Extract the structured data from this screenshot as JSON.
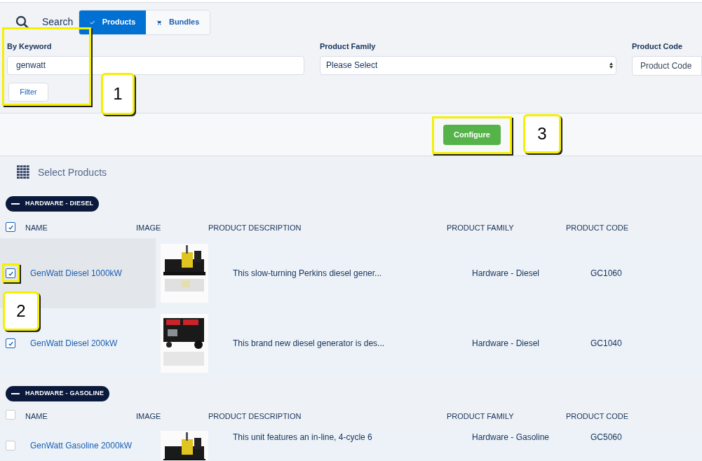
{
  "search": {
    "label": "Search",
    "tabs": [
      {
        "label": "Products",
        "kind": "check",
        "selected": true
      },
      {
        "label": "Bundles",
        "kind": "cart",
        "selected": false
      }
    ]
  },
  "filters": {
    "keyword": {
      "label": "By Keyword",
      "value": "genwatt",
      "button": "Filter",
      "callout": "1"
    },
    "family": {
      "label": "Product Family",
      "value": "Please Select"
    },
    "code": {
      "label": "Product Code",
      "placeholder": "Product Code"
    }
  },
  "configure": {
    "button": "Configure",
    "callout": "3"
  },
  "heading": "Select Products",
  "groups": [
    {
      "label": "HARDWARE - DIESEL",
      "expanded": true,
      "all_checked": true,
      "columns": [
        "NAME",
        "IMAGE",
        "PRODUCT DESCRIPTION",
        "PRODUCT FAMILY",
        "PRODUCT CODE"
      ],
      "rows": [
        {
          "name": "GenWatt Diesel 1000kW",
          "description": "This slow-turning Perkins diesel gener...",
          "family": "Hardware - Diesel",
          "code": "GC1060",
          "checked": true,
          "selected": true,
          "callout": "2"
        },
        {
          "name": "GenWatt Diesel 200kW",
          "description": "This brand new diesel generator is des...",
          "family": "Hardware - Diesel",
          "code": "GC1040",
          "checked": true,
          "selected": false
        }
      ]
    },
    {
      "label": "HARDWARE - GASOLINE",
      "expanded": true,
      "all_checked": false,
      "columns": [
        "NAME",
        "IMAGE",
        "PRODUCT DESCRIPTION",
        "PRODUCT FAMILY",
        "PRODUCT CODE"
      ],
      "rows": [
        {
          "name": "GenWatt Gasoline 2000kW",
          "description": "This unit features an in-line, 4-cycle 6",
          "family": "Hardware - Gasoline",
          "code": "GC5060",
          "checked": false,
          "selected": false
        }
      ]
    }
  ]
}
